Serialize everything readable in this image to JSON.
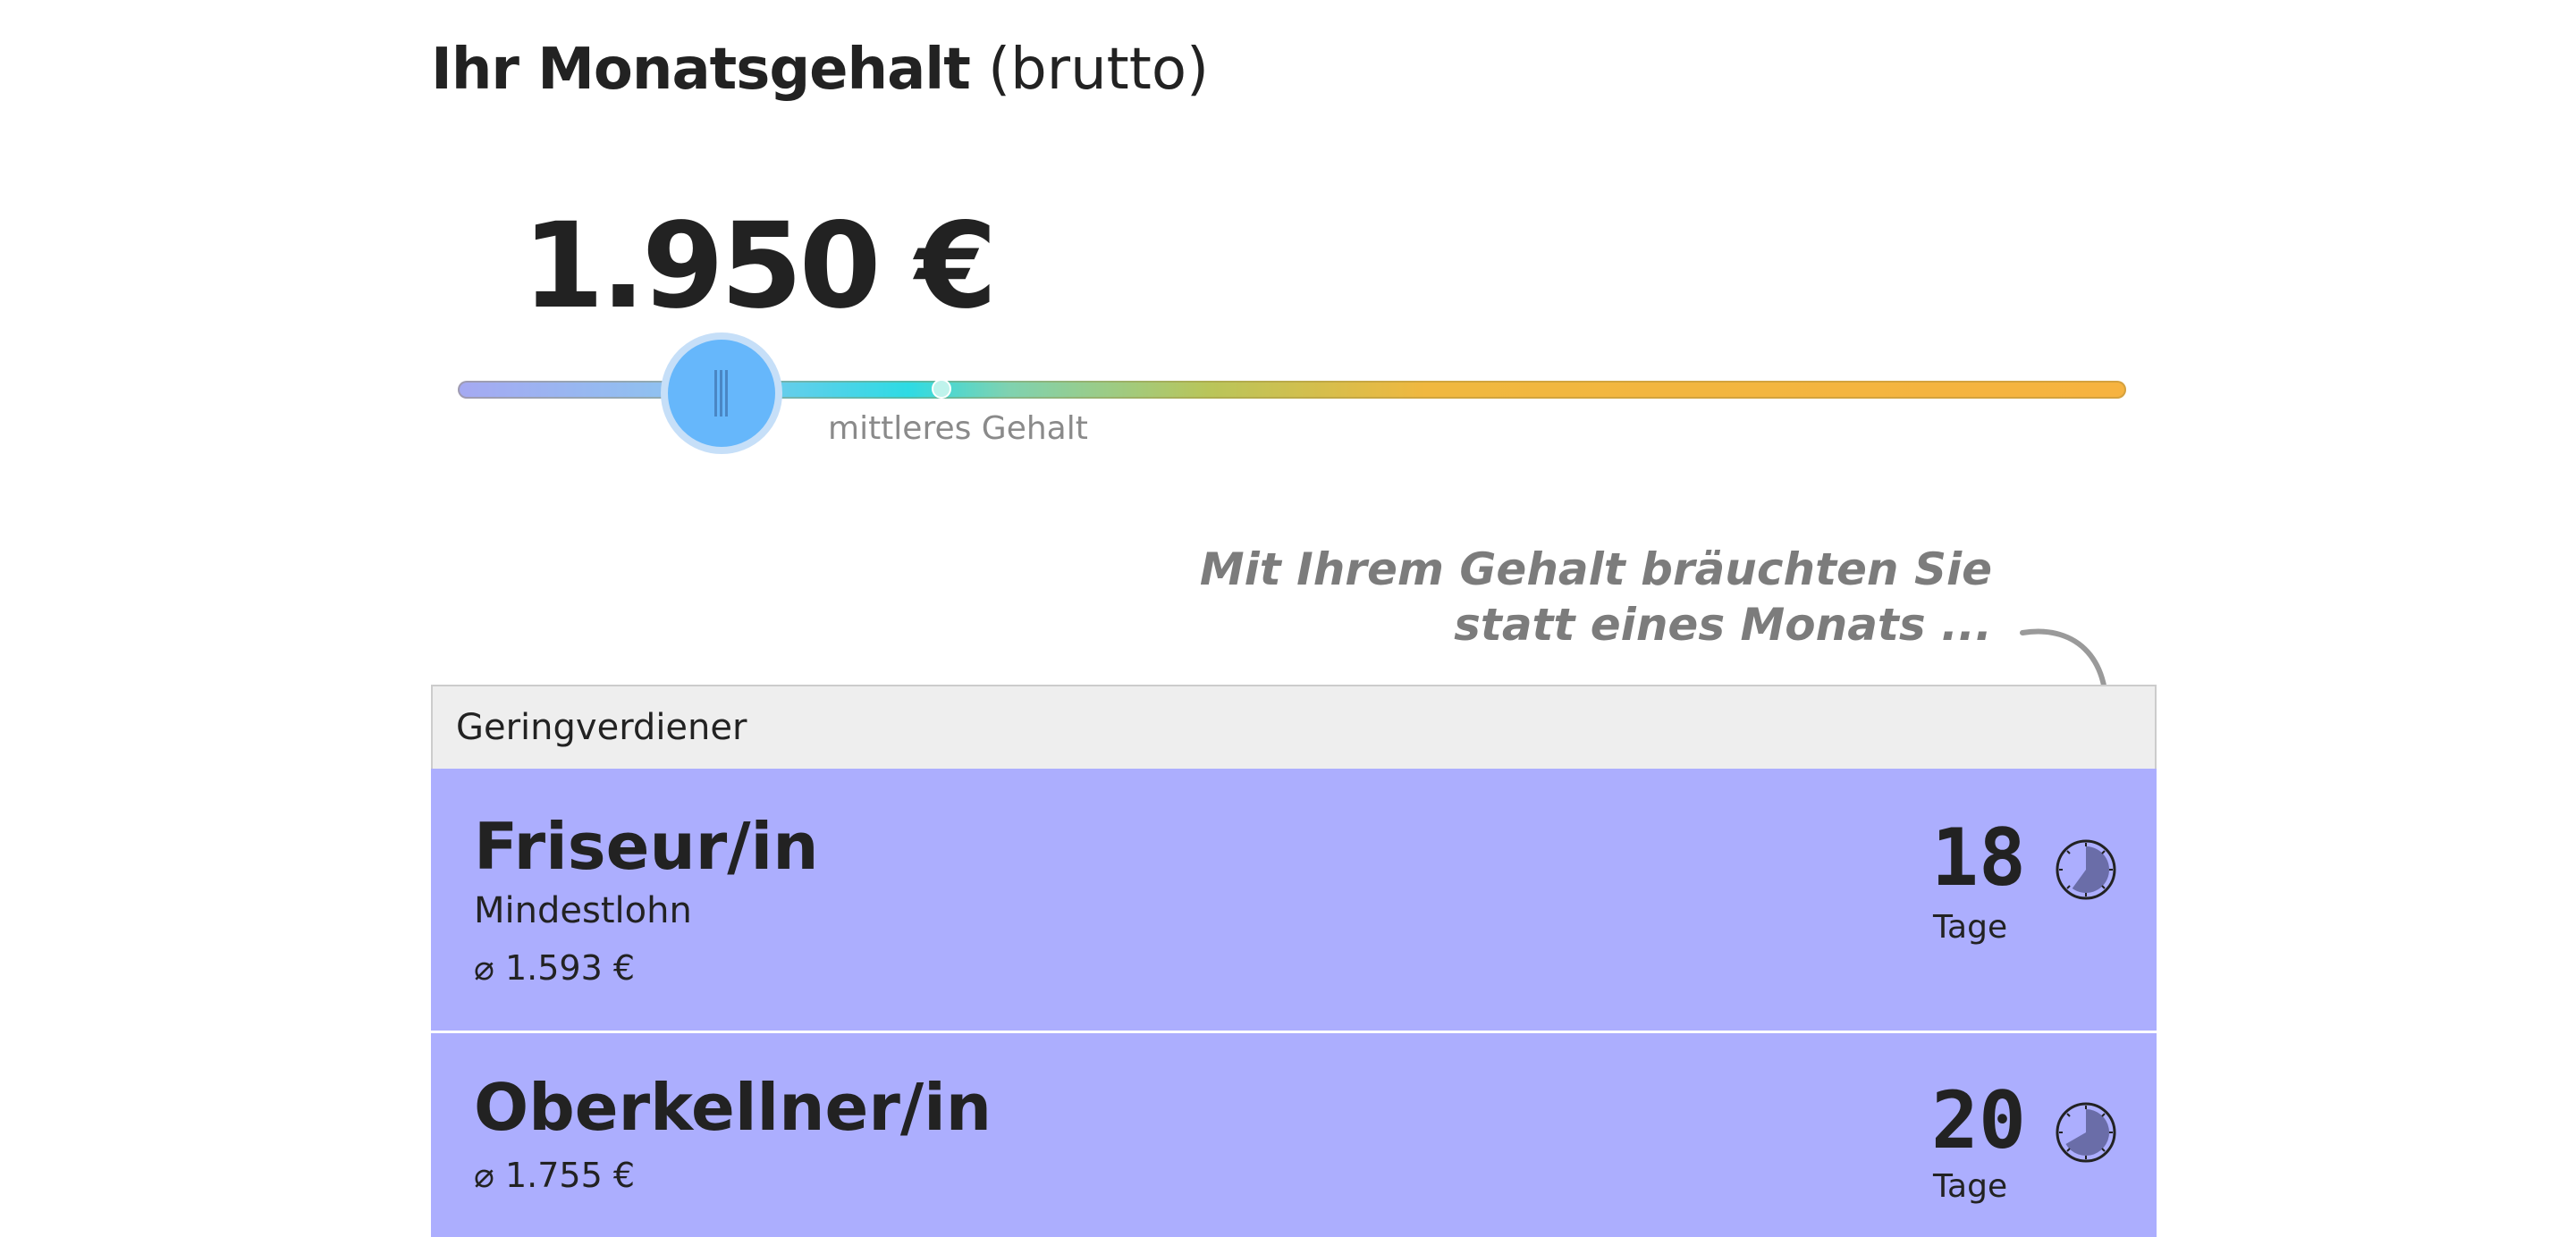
{
  "heading": {
    "bold": "Ihr Monatsgehalt",
    "light": "(brutto)"
  },
  "salary": {
    "value": "1.950 €",
    "slider_position": 0.158,
    "median_position": 0.29,
    "median_label": "mittleres Gehalt"
  },
  "note": {
    "line1": "Mit Ihrem Gehalt bräuchten Sie",
    "line2": "statt eines Monats ..."
  },
  "table": {
    "group": "Geringverdiener",
    "rows": [
      {
        "title": "Friseur/in",
        "subtitle": "Mindestlohn",
        "avg": "⌀ 1.593 €",
        "days": "18",
        "days_unit": "Tage",
        "fraction_of_month": 0.6
      },
      {
        "title": "Oberkellner/in",
        "subtitle": "",
        "avg": "⌀ 1.755 €",
        "days": "20",
        "days_unit": "Tage",
        "fraction_of_month": 0.667
      }
    ]
  },
  "colors": {
    "row_bg": "#acaefe",
    "thumb": "#66b7fb",
    "note": "#7c7c7c"
  },
  "icons": {
    "timer": "stopwatch-icon",
    "arrow": "curved-arrow-down-icon"
  }
}
